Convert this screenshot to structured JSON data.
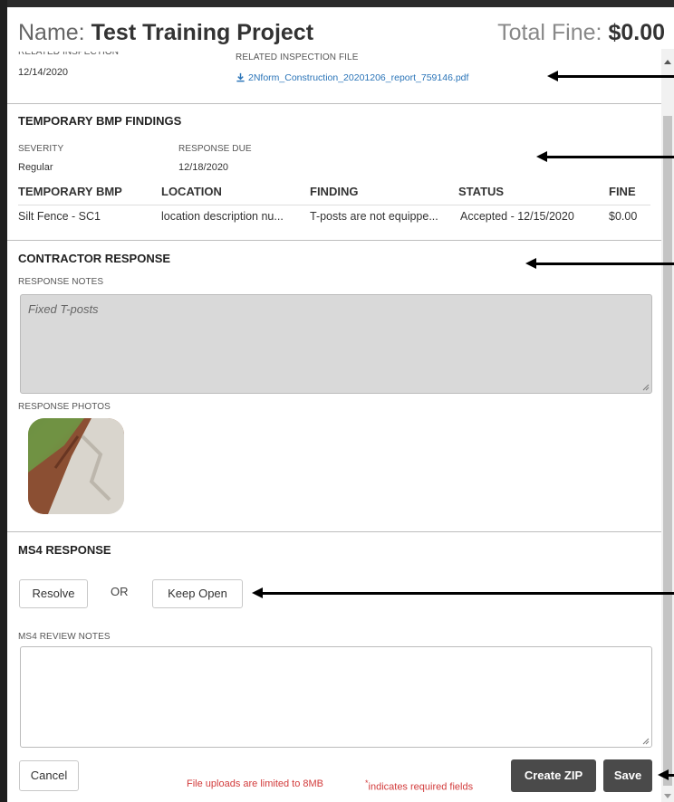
{
  "header": {
    "name_label": "Name:",
    "project_name": "Test Training Project",
    "total_fine_label": "Total Fine:",
    "total_fine_value": "$0.00"
  },
  "inspection": {
    "related_inspection_label": "RELATED INSPECTION",
    "related_inspection_date": "12/14/2020",
    "related_file_label": "RELATED INSPECTION FILE",
    "related_file_name": "2Nform_Construction_20201206_report_759146.pdf"
  },
  "findings": {
    "title": "TEMPORARY BMP FINDINGS",
    "severity_label": "SEVERITY",
    "severity_value": "Regular",
    "response_due_label": "RESPONSE DUE",
    "response_due_value": "12/18/2020",
    "columns": [
      "TEMPORARY BMP",
      "LOCATION",
      "FINDING",
      "STATUS",
      "FINE"
    ],
    "rows": [
      [
        "Silt Fence - SC1",
        "location description nu...",
        "T-posts are not equippe...",
        "Accepted - 12/15/2020",
        "$0.00"
      ]
    ]
  },
  "contractor_response": {
    "title": "CONTRACTOR RESPONSE",
    "notes_label": "RESPONSE NOTES",
    "notes_value": "Fixed T-posts",
    "photos_label": "RESPONSE PHOTOS"
  },
  "ms4_response": {
    "title": "MS4 RESPONSE",
    "resolve_label": "Resolve",
    "or_label": "OR",
    "keep_open_label": "Keep Open",
    "review_notes_label": "MS4 REVIEW NOTES",
    "review_notes_value": ""
  },
  "footer": {
    "cancel_label": "Cancel",
    "upload_limit_text": "File uploads are limited to 8MB",
    "required_marker": "*",
    "required_text": "indicates required fields",
    "create_zip_label": "Create ZIP",
    "save_label": "Save"
  },
  "colors": {
    "link": "#2a74b8",
    "warning": "#d23b3b",
    "dark_button": "#4a4a4a"
  }
}
